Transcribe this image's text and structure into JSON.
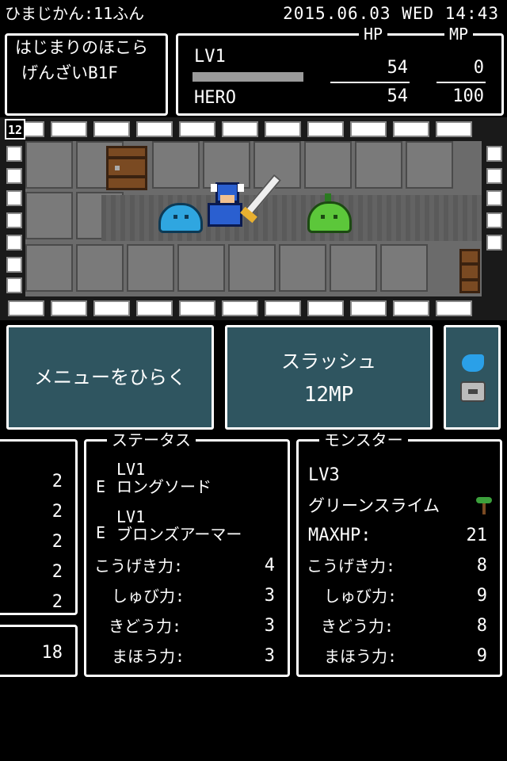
{
  "status_bar": {
    "elapsed": "ひまじかん:11ふん",
    "datetime": "2015.06.03 WED 14:43"
  },
  "location": {
    "line1": "はじまりのほこら",
    "line2": "げんざいB1F"
  },
  "hero_panel": {
    "level": "LV1",
    "name": "HERO",
    "hp_label": "HP",
    "mp_label": "MP",
    "hp_current": "54",
    "hp_max": "54",
    "mp_current": "0",
    "mp_max": "100",
    "exp_fill": 1.0
  },
  "dungeon": {
    "floor_badge": "12"
  },
  "actions": {
    "menu_label": "メニューをひらく",
    "skill_name": "スラッシュ",
    "skill_cost": "12MP"
  },
  "left_stats": {
    "values": [
      "2",
      "2",
      "2",
      "2",
      "2"
    ],
    "total": "18"
  },
  "status_panel": {
    "title": "ステータス",
    "weapon_marker": "E",
    "weapon_level": "LV1",
    "weapon_name": "ロングソード",
    "armor_marker": "E",
    "armor_level": "LV1",
    "armor_name": "ブロンズアーマー",
    "rows": [
      {
        "label": "こうげき力:",
        "value": "4"
      },
      {
        "label": "しゅび力:",
        "value": "3"
      },
      {
        "label": "きどう力:",
        "value": "3"
      },
      {
        "label": "まほう力:",
        "value": "3"
      }
    ]
  },
  "monster_panel": {
    "title": "モンスター",
    "level": "LV3",
    "name": "グリーンスライム",
    "maxhp_label": "MAXHP:",
    "maxhp_value": "21",
    "rows": [
      {
        "label": "こうげき力:",
        "value": "8"
      },
      {
        "label": "しゅび力:",
        "value": "9"
      },
      {
        "label": "きどう力:",
        "value": "8"
      },
      {
        "label": "まほう力:",
        "value": "9"
      }
    ]
  },
  "colors": {
    "button_bg": "#2f5560",
    "slime_blue": "#2fa6e0",
    "slime_green": "#5cc73a",
    "hero_blue": "#2a5fd0"
  }
}
